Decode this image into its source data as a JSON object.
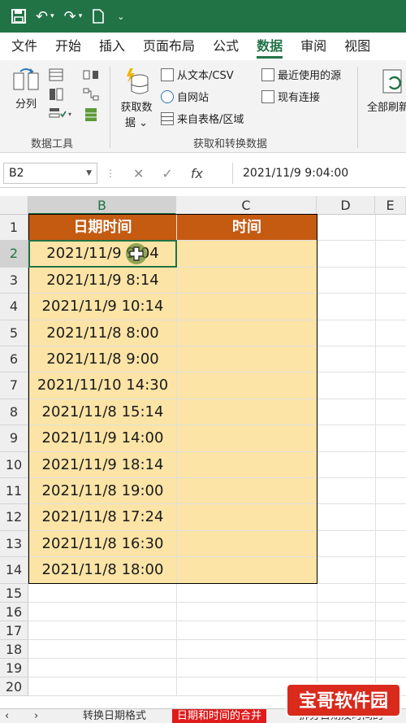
{
  "titlebar": {
    "icons": [
      "save-icon",
      "undo-icon",
      "redo-icon",
      "new-file-icon",
      "customize-qat-icon"
    ]
  },
  "ribbon_tabs": [
    "文件",
    "开始",
    "插入",
    "页面布局",
    "公式",
    "数据",
    "审阅",
    "视图"
  ],
  "active_tab": "数据",
  "ribbon": {
    "split_label": "分列",
    "group_data_tools": "数据工具",
    "get_data_label_1": "获取数",
    "get_data_label_2": "据",
    "from_text_csv": "从文本/CSV",
    "from_web": "自网站",
    "from_table": "来自表格/区域",
    "recent_sources": "最近使用的源",
    "existing_connections": "现有连接",
    "group_get_transform": "获取和转换数据",
    "refresh_all": "全部刷新"
  },
  "formula_bar": {
    "name_box": "B2",
    "cancel": "✕",
    "enter": "✓",
    "fx": "fx",
    "value": "2021/11/9  9:04:00"
  },
  "grid": {
    "columns": [
      "B",
      "C",
      "D",
      "E"
    ],
    "selected_column": "B",
    "rows": [
      "1",
      "2",
      "3",
      "4",
      "5",
      "6",
      "7",
      "8",
      "9",
      "10",
      "11",
      "12",
      "13",
      "14",
      "15",
      "16",
      "17",
      "18",
      "19",
      "20"
    ],
    "selected_row": "2",
    "header_b": "日期时间",
    "header_c": "时间",
    "values_b": [
      "2021/11/9 9:04",
      "2021/11/9 8:14",
      "2021/11/9 10:14",
      "2021/11/8 8:00",
      "2021/11/8 9:00",
      "2021/11/10 14:30",
      "2021/11/8 15:14",
      "2021/11/9 14:00",
      "2021/11/9 18:14",
      "2021/11/8 19:00",
      "2021/11/8 17:24",
      "2021/11/8 16:30",
      "2021/11/8 18:00"
    ]
  },
  "sheet_tabs": [
    "转换日期格式",
    "日期和时间的合并",
    "拆分日期及时间的"
  ],
  "active_sheet": "日期和时间的合并",
  "watermark": "宝哥软件园",
  "colors": {
    "excel_green": "#217346",
    "header_fill": "#c55a11",
    "cell_fill": "#fce4a6",
    "active_sheet": "#e01b1b"
  }
}
